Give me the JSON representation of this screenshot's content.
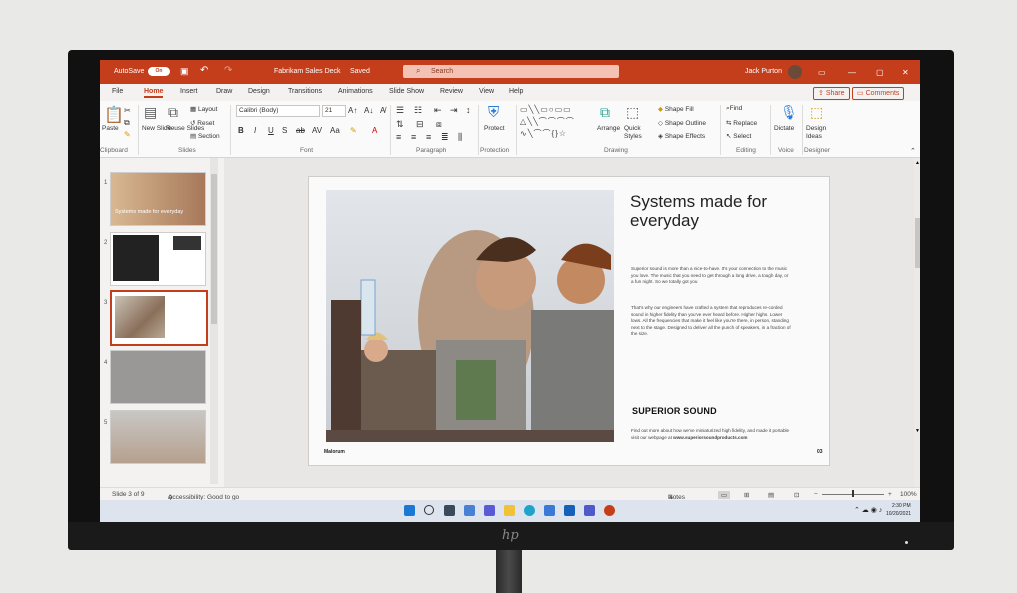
{
  "titlebar": {
    "autosave_label": "AutoSave",
    "autosave_state": "On",
    "doc_title": "Fabrikam Sales Deck",
    "save_status": "Saved",
    "search_placeholder": "Search",
    "user_name": "Jack Purton"
  },
  "tabs": [
    "File",
    "Home",
    "Insert",
    "Draw",
    "Design",
    "Transitions",
    "Animations",
    "Slide Show",
    "Review",
    "View",
    "Help"
  ],
  "active_tab": "Home",
  "share_label": "Share",
  "comments_label": "Comments",
  "ribbon": {
    "paste": "Paste",
    "new_slide": "New Slide",
    "reuse_slides": "Reuse Slides",
    "layout": "Layout",
    "reset": "Reset",
    "section": "Section",
    "font_name": "Calibri (Body)",
    "font_size": "21",
    "protect": "Protect",
    "arrange": "Arrange",
    "quick_styles": "Quick Styles",
    "shape_fill": "Shape Fill",
    "shape_outline": "Shape Outline",
    "shape_effects": "Shape Effects",
    "find": "Find",
    "replace": "Replace",
    "select": "Select",
    "dictate": "Dictate",
    "design_ideas": "Design Ideas",
    "groups": {
      "clipboard": "Clipboard",
      "slides": "Slides",
      "font": "Font",
      "paragraph": "Paragraph",
      "protection": "Protection",
      "drawing": "Drawing",
      "editing": "Editing",
      "voice": "Voice",
      "designer": "Designer"
    }
  },
  "thumbnails": [
    {
      "num": "1",
      "text": "Systems made for everyday"
    },
    {
      "num": "2",
      "text": ""
    },
    {
      "num": "3",
      "text": ""
    },
    {
      "num": "4",
      "text": ""
    },
    {
      "num": "5",
      "text": ""
    }
  ],
  "slide": {
    "title": "Systems made for everyday",
    "para1": "Superior sound is more than a nice-to-have. It's your connection to the music you love. The music that you need to get through a long drive, a tough day, or a fun night. So we totally got you",
    "para2": "That's why our engineers have crafted a system that reproduces re-corded sound in higher fidelity than you've ever heard before. Higher highs. Lower lows. All the frequencies that make it feel like you're there, in person, standing next to the stage. Designed to deliver all the punch of speakers, in a fraction of the size.",
    "heading": "SUPERIOR SOUND",
    "para3_prefix": "Find out more about how we've miniaturized high fidelity, and made it portable visit our webpage at ",
    "para3_link": "www.superiorsoundproducts.com",
    "brand": "Malorum",
    "page": "03"
  },
  "status": {
    "slide_info": "Slide 3 of 9",
    "accessibility": "Accessibility: Good to go",
    "notes": "Notes",
    "zoom": "100%"
  },
  "taskbar": {
    "time": "2:30 PM",
    "date": "10/20/2021"
  },
  "colors": {
    "accent": "#c43e1c",
    "taskbar": "#dde4ee"
  },
  "bezel_logo": "hp"
}
